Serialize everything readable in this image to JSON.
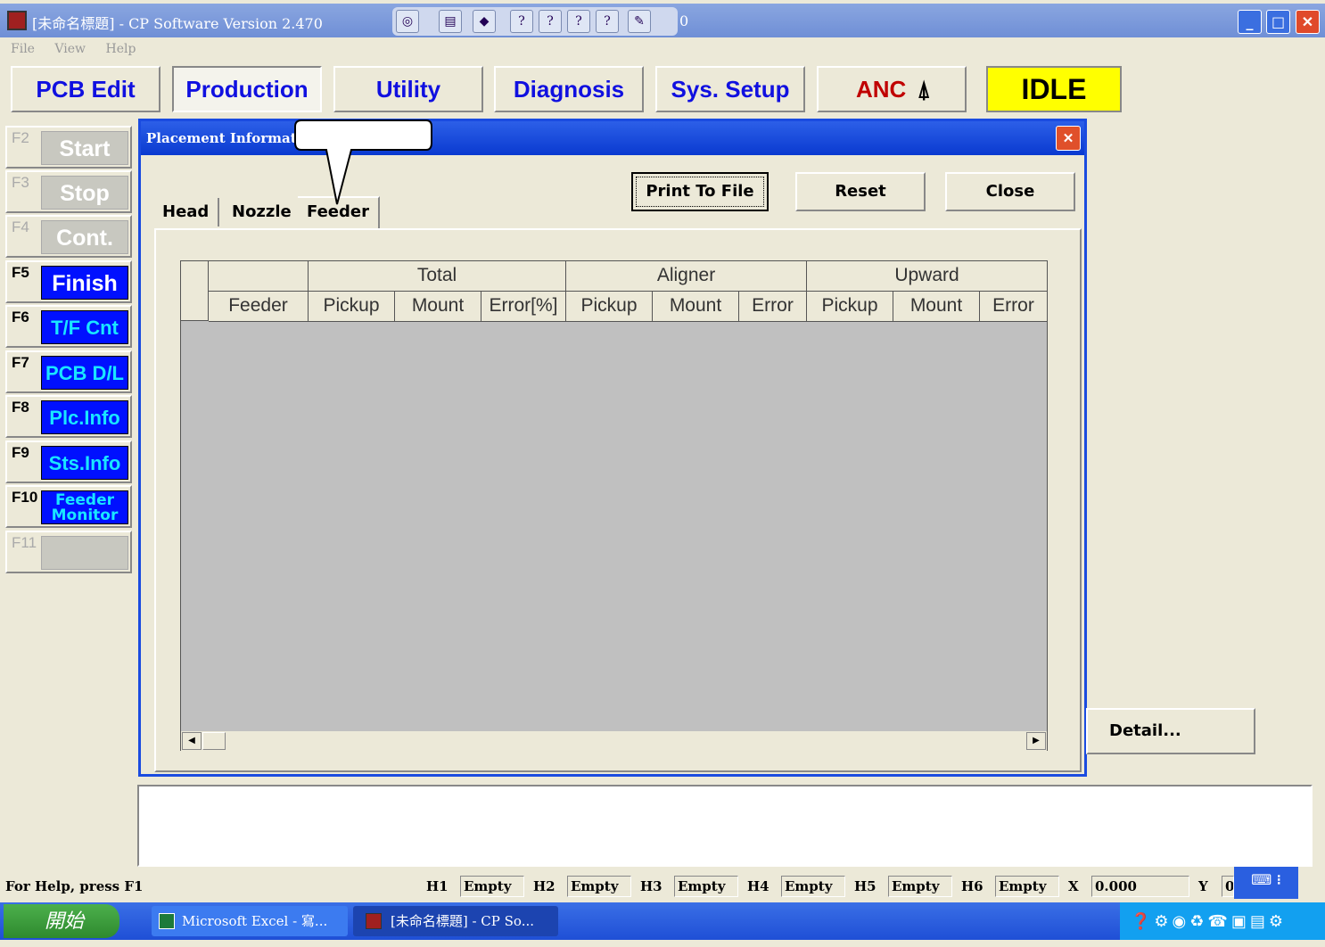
{
  "window": {
    "title": "[未命名標題] - CP Software Version 2.470",
    "toolbar_value": "0"
  },
  "menu": [
    "File",
    "View",
    "Help"
  ],
  "top_tabs": [
    "PCB Edit",
    "Production",
    "Utility",
    "Diagnosis",
    "Sys. Setup",
    "ANC"
  ],
  "machine_state": "IDLE",
  "colors": {
    "state_bg": "#ffff00",
    "anc": "#c00000",
    "side_btn": "#0010ff",
    "side_text": "#19e6ff"
  },
  "side_buttons": [
    {
      "key": "F2",
      "label": "Start",
      "enabled": false
    },
    {
      "key": "F3",
      "label": "Stop",
      "enabled": false
    },
    {
      "key": "F4",
      "label": "Cont.",
      "enabled": false
    },
    {
      "key": "F5",
      "label": "Finish",
      "enabled": true
    },
    {
      "key": "F6",
      "label": "T/F Cnt",
      "enabled": true
    },
    {
      "key": "F7",
      "label": "PCB D/L",
      "enabled": true
    },
    {
      "key": "F8",
      "label": "Plc.Info",
      "enabled": true
    },
    {
      "key": "F9",
      "label": "Sts.Info",
      "enabled": true
    },
    {
      "key": "F10",
      "label": "Feeder Monitor",
      "enabled": true
    },
    {
      "key": "F11",
      "label": "",
      "enabled": false
    }
  ],
  "dialog": {
    "title": "Placement Informati",
    "buttons": {
      "print": "Print To File",
      "reset": "Reset",
      "close": "Close"
    },
    "tabs": [
      "Head",
      "Nozzle",
      "Feeder"
    ],
    "groups": [
      "Total",
      "Aligner",
      "Upward"
    ],
    "columns": [
      "Feeder",
      "Pickup",
      "Mount",
      "Error[%]",
      "Pickup",
      "Mount",
      "Error",
      "Pickup",
      "Mount",
      "Error"
    ]
  },
  "detail_button": "Detail...",
  "status": {
    "help": "For Help, press F1",
    "heads": [
      {
        "k": "H1",
        "v": "Empty"
      },
      {
        "k": "H2",
        "v": "Empty"
      },
      {
        "k": "H3",
        "v": "Empty"
      },
      {
        "k": "H4",
        "v": "Empty"
      },
      {
        "k": "H5",
        "v": "Empty"
      },
      {
        "k": "H6",
        "v": "Empty"
      }
    ],
    "x_label": "X",
    "x": "0.000",
    "y_label": "Y",
    "y": "0"
  },
  "taskbar": {
    "start": "開始",
    "items": [
      "Microsoft Excel - 寫...",
      "[未命名標題] - CP So..."
    ]
  }
}
